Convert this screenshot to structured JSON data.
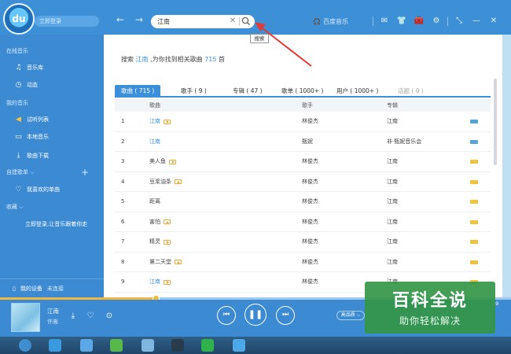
{
  "header": {
    "logo_text": "du",
    "login_label": "立即登录",
    "search_value": "江南",
    "search_tooltip": "搜索",
    "brand_label": "百度音乐"
  },
  "sidebar": {
    "online_section": "在线音乐",
    "music_library": "音乐库",
    "dynamic": "动态",
    "my_music_section": "我的音乐",
    "listen_list": "试听列表",
    "local_music": "本地音乐",
    "downloads": "歌曲下载",
    "custom_playlists": "自建歌单",
    "favorite_songs": "我喜欢的单曲",
    "collection_section": "收藏",
    "collection_prompt": "立即登录,让音乐跟着你走",
    "my_device": "我的设备",
    "not_connected": "未连接"
  },
  "main": {
    "result_prefix": "搜索",
    "result_keyword": "江南",
    "result_middle": ",为你找到相关歌曲",
    "result_count": "715",
    "result_suffix": "首",
    "tabs": [
      {
        "label": "歌曲 ( 715 )"
      },
      {
        "label": "歌手 ( 9 )"
      },
      {
        "label": "专辑 ( 47 )"
      },
      {
        "label": "歌单 ( 1000+ )"
      },
      {
        "label": "用户 ( 1000+ )"
      },
      {
        "label": "话题 ( 0 )"
      }
    ],
    "columns": {
      "song": "歌曲",
      "artist": "歌手",
      "album": "专辑"
    },
    "rows": [
      {
        "no": "1",
        "song": "江南",
        "artist": "林俊杰",
        "album": "江南",
        "quality": "HQ"
      },
      {
        "no": "2",
        "song": "江南",
        "artist": "甄妮",
        "album": "非·甄妮音乐会",
        "quality": "HQ"
      },
      {
        "no": "3",
        "song": "美人鱼",
        "artist": "林俊杰",
        "album": "江南",
        "quality": "SQ"
      },
      {
        "no": "4",
        "song": "豆浆油条",
        "artist": "林俊杰",
        "album": "江南",
        "quality": "SQ"
      },
      {
        "no": "5",
        "song": "距离",
        "artist": "林俊杰",
        "album": "江南",
        "quality": "SQ"
      },
      {
        "no": "6",
        "song": "害怕",
        "artist": "林俊杰",
        "album": "江南",
        "quality": "SQ"
      },
      {
        "no": "7",
        "song": "精灵",
        "artist": "林俊杰",
        "album": "江南",
        "quality": "SQ"
      },
      {
        "no": "8",
        "song": "第二天堂",
        "artist": "林俊杰",
        "album": "江南",
        "quality": "SQ"
      },
      {
        "no": "9",
        "song": "江南",
        "artist": "林俊杰",
        "album": "江南",
        "quality": "SQ"
      }
    ]
  },
  "player": {
    "title": "江南",
    "artist": "许嵩",
    "quality_label": "高品质",
    "time_tail": "19",
    "progress": 0.305
  },
  "watermark": {
    "big": "百科全说",
    "small": "助你轻松解决"
  },
  "colors": {
    "accent": "#3a8fd8",
    "sidebar": "#3b8ad2",
    "progress": "#f2b63a",
    "watermark": "#349646"
  }
}
